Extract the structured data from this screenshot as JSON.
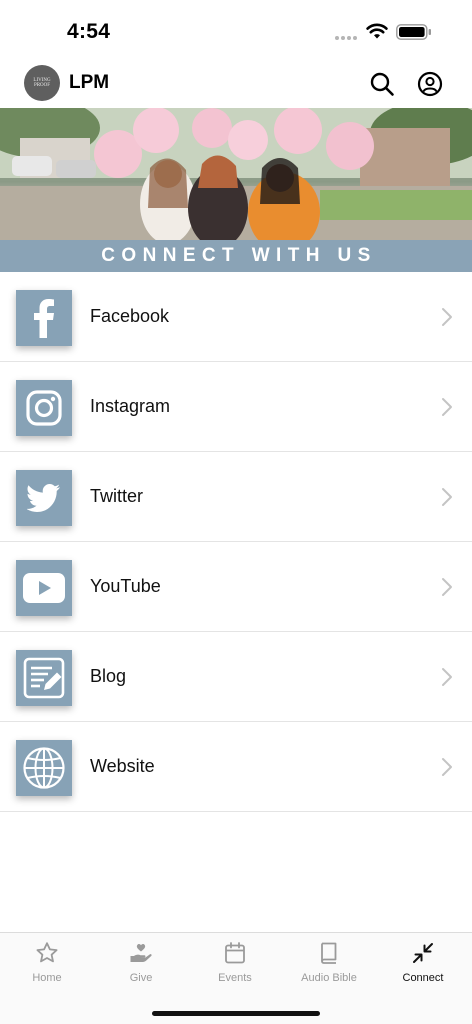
{
  "status_bar": {
    "time": "4:54",
    "icons": [
      "signal-dots",
      "wifi-icon",
      "battery-icon"
    ]
  },
  "header": {
    "logo_text": "LIVING PROOF",
    "title": "LPM",
    "icons": [
      "search-icon",
      "account-icon"
    ]
  },
  "banner": {
    "text": "CONNECT WITH US"
  },
  "links": [
    {
      "label": "Facebook",
      "icon": "facebook-icon"
    },
    {
      "label": "Instagram",
      "icon": "instagram-icon"
    },
    {
      "label": "Twitter",
      "icon": "twitter-icon"
    },
    {
      "label": "YouTube",
      "icon": "youtube-icon"
    },
    {
      "label": "Blog",
      "icon": "blog-icon"
    },
    {
      "label": "Website",
      "icon": "globe-icon"
    }
  ],
  "tab_bar": {
    "tabs": [
      {
        "label": "Home",
        "icon": "star-icon"
      },
      {
        "label": "Give",
        "icon": "give-icon"
      },
      {
        "label": "Events",
        "icon": "calendar-icon"
      },
      {
        "label": "Audio Bible",
        "icon": "book-icon"
      },
      {
        "label": "Connect",
        "icon": "connect-icon"
      }
    ],
    "active": "Connect"
  },
  "colors": {
    "accent_tile": "#87a2b6",
    "banner": "#8aa3b6",
    "tab_inactive": "#9a9a9a",
    "tab_active": "#111111"
  }
}
